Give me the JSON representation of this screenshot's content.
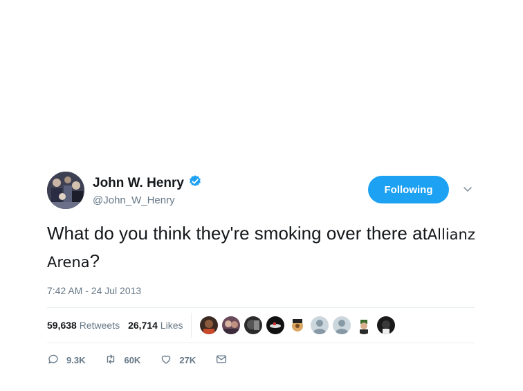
{
  "author": {
    "display_name": "John W. Henry",
    "handle": "@John_W_Henry",
    "verified_icon": "verified-badge-icon"
  },
  "follow_button": {
    "label": "Following"
  },
  "tweet": {
    "text_main": "What do you think they're smoking over there at",
    "text_edited": "Allianz Arena",
    "text_end": "?"
  },
  "timestamp": "7:42 AM - 24 Jul 2013",
  "stats": {
    "retweets_count": "59,638",
    "retweets_label": "Retweets",
    "likes_count": "26,714",
    "likes_label": "Likes"
  },
  "actions": {
    "reply_count": "9.3K",
    "retweet_count": "60K",
    "like_count": "27K"
  },
  "colors": {
    "accent": "#1da1f2",
    "muted": "#657786",
    "text": "#14171a"
  }
}
